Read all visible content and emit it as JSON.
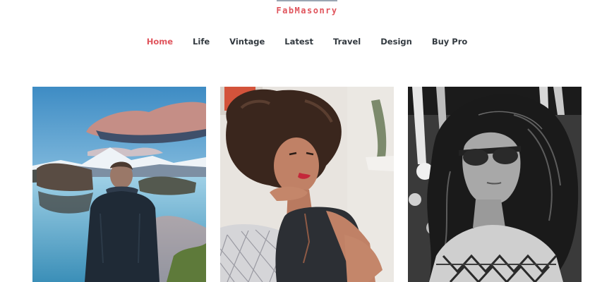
{
  "site": {
    "logo": "FabMasonry"
  },
  "nav": {
    "items": [
      {
        "label": "Home",
        "active": true
      },
      {
        "label": "Life"
      },
      {
        "label": "Vintage"
      },
      {
        "label": "Latest"
      },
      {
        "label": "Travel"
      },
      {
        "label": "Design"
      },
      {
        "label": "Buy Pro"
      }
    ]
  },
  "colors": {
    "accent": "#e0545c",
    "nav_text": "#333a40"
  },
  "cards": [
    {
      "image": "man-at-mountain-lake-photo"
    },
    {
      "image": "curly-haired-woman-portrait-photo"
    },
    {
      "image": "black-and-white-woman-sunglasses-photo"
    }
  ]
}
